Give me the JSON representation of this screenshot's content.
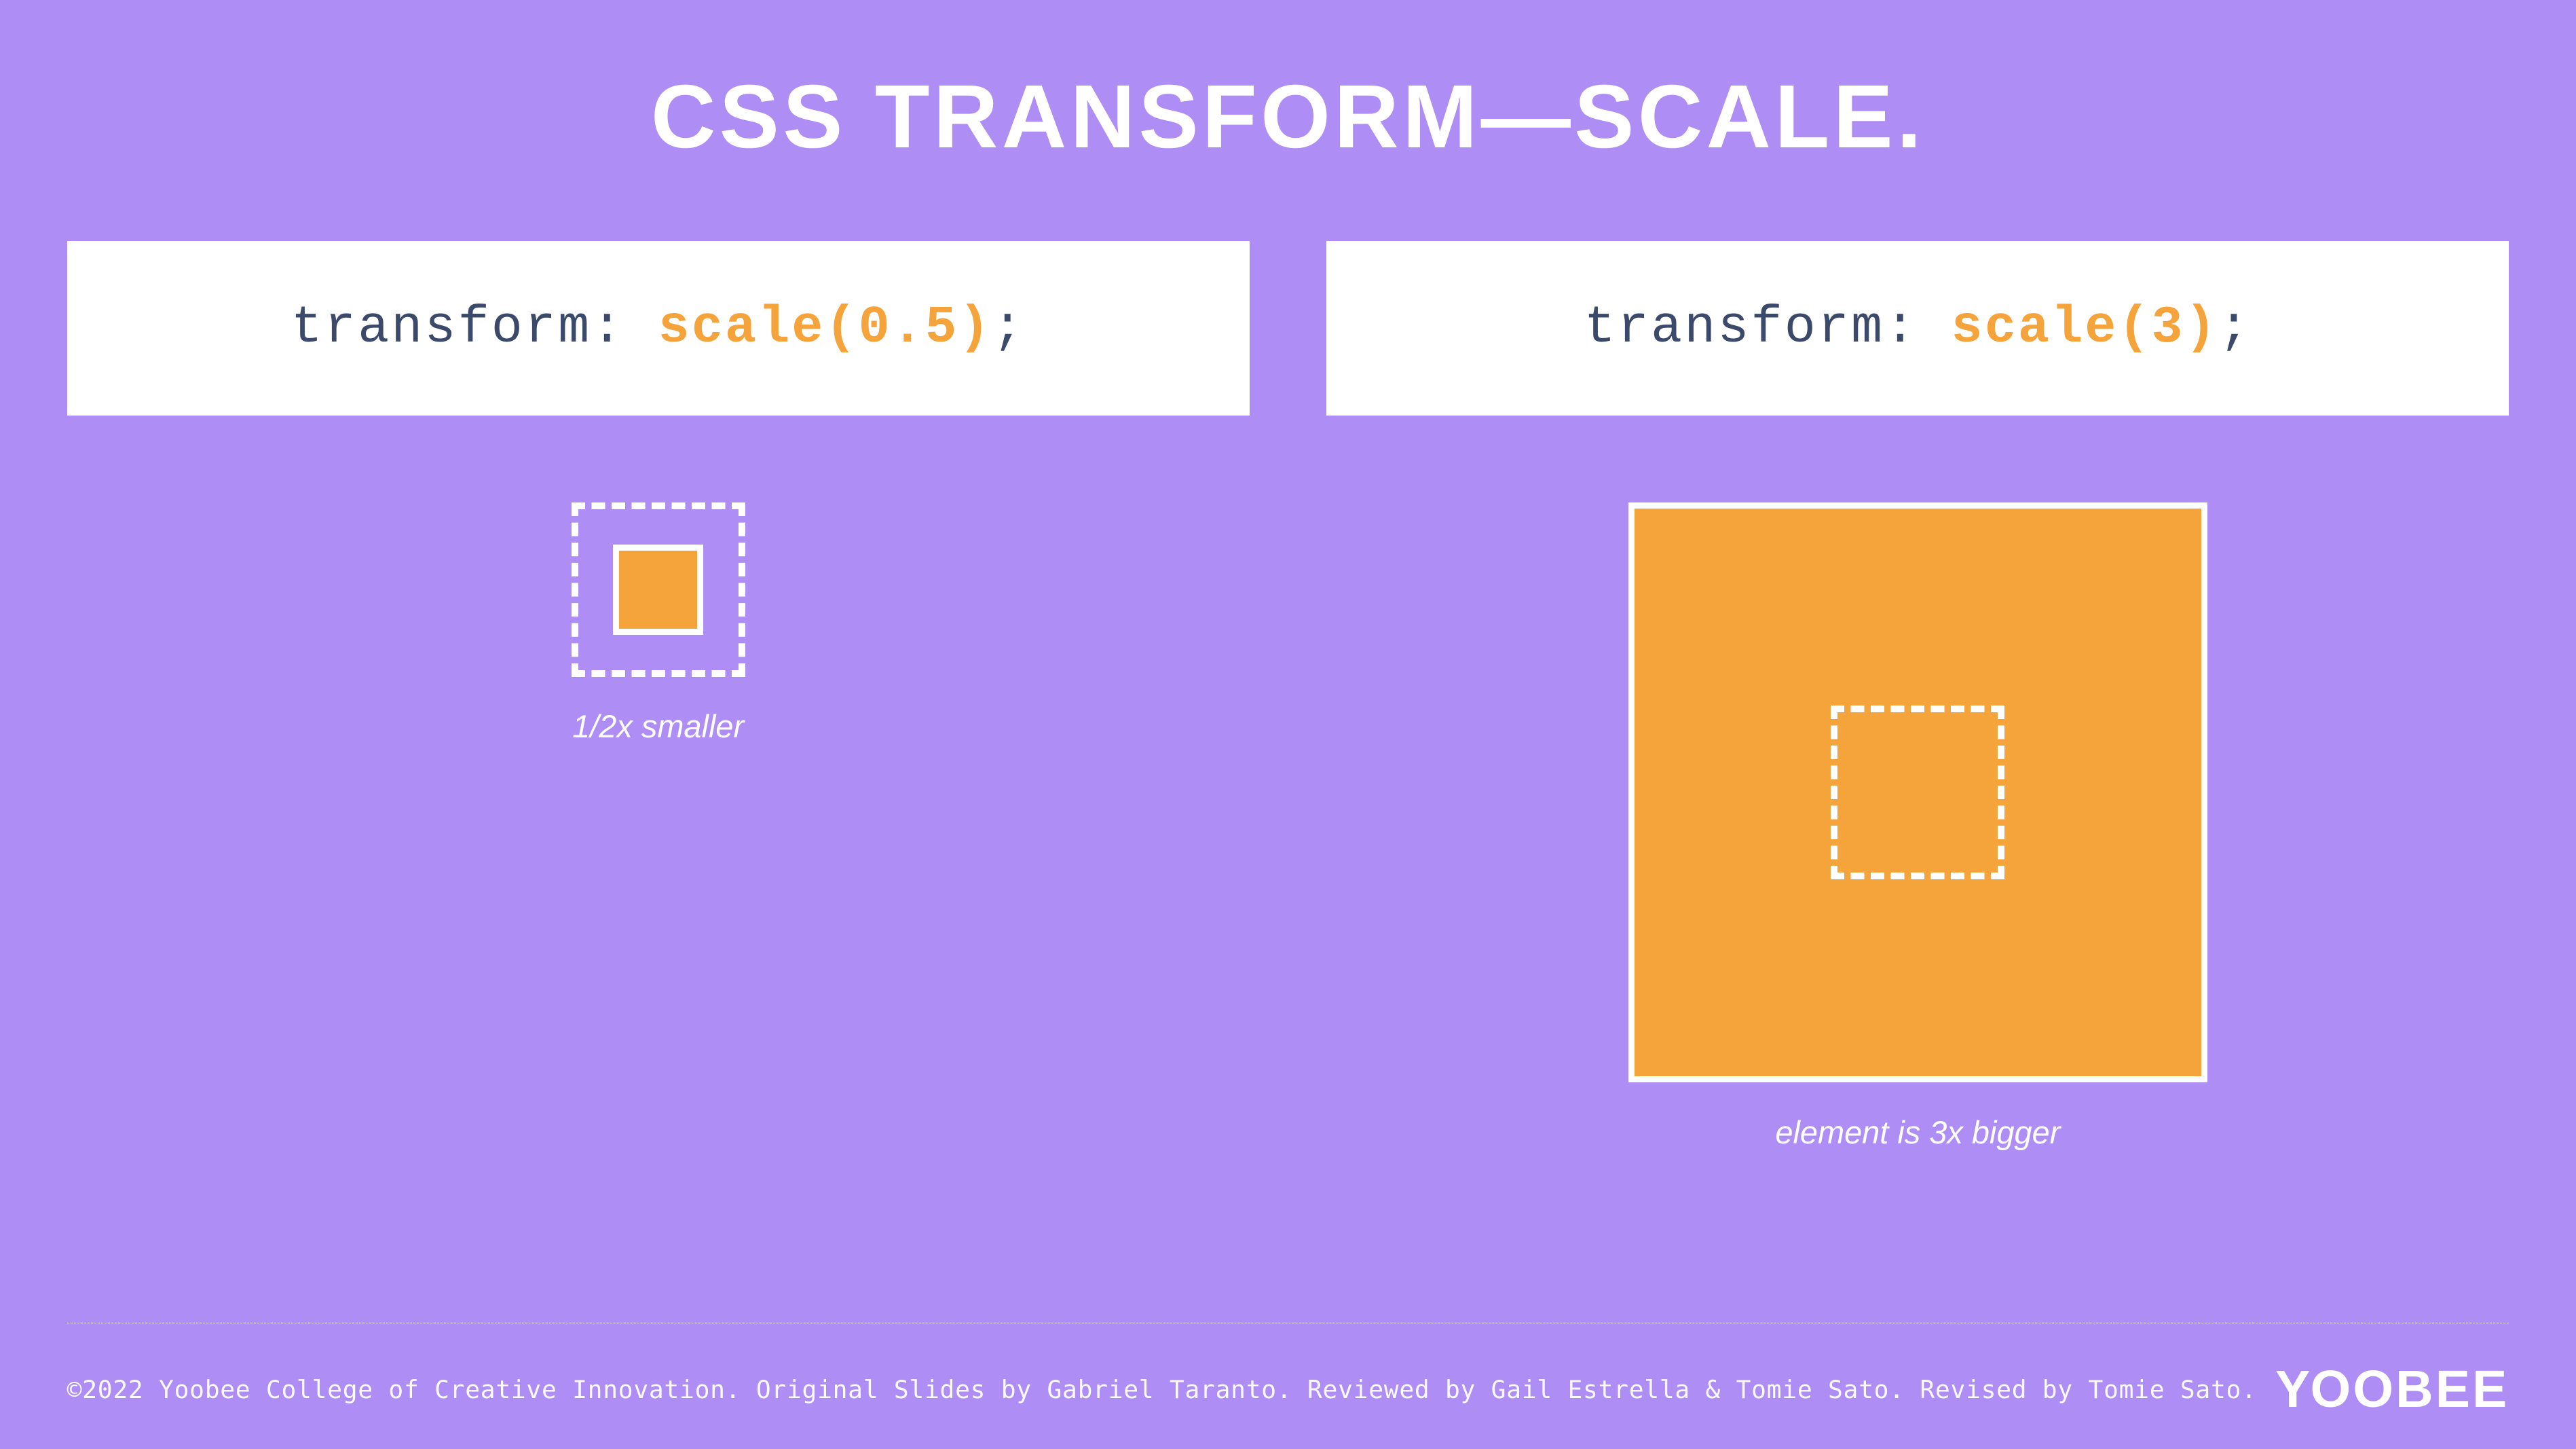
{
  "title": "CSS TRANSFORM—SCALE.",
  "left": {
    "code_prop": "transform",
    "code_val": "scale(0.5)",
    "caption": "1/2x smaller"
  },
  "right": {
    "code_prop": "transform",
    "code_val": "scale(3)",
    "caption": "element is 3x bigger"
  },
  "footer": {
    "credits": "©2022 Yoobee College of Creative Innovation.  Original Slides by Gabriel Taranto.  Reviewed by Gail Estrella & Tomie Sato.  Revised by Tomie Sato.",
    "logo": "YOOBEE"
  }
}
